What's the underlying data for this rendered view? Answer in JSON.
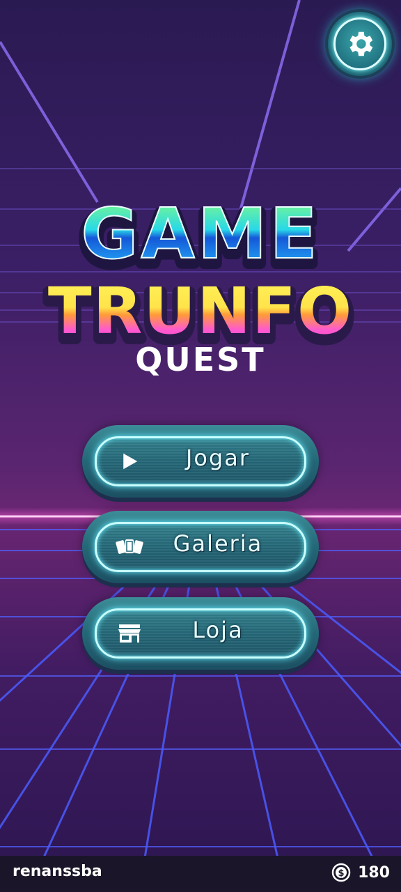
{
  "logo": {
    "line1": "GAME",
    "line2": "TRUNFO",
    "line3": "QUEST"
  },
  "settings": {
    "icon": "gear-icon"
  },
  "menu": {
    "buttons": [
      {
        "label": "Jogar",
        "icon": "play-icon"
      },
      {
        "label": "Galeria",
        "icon": "cards-icon"
      },
      {
        "label": "Loja",
        "icon": "store-icon"
      }
    ]
  },
  "footer": {
    "username": "renanssba",
    "coins": "180",
    "coin_icon": "coin-icon"
  },
  "colors": {
    "accent_cyan": "#c8ffff",
    "button_teal": "#246777",
    "horizon_pink": "#ff4fd8",
    "grid_blue": "#4f62ff",
    "logo_green": "#5ff08a",
    "logo_yellow": "#fff04a",
    "logo_pink": "#ff5fd0"
  }
}
